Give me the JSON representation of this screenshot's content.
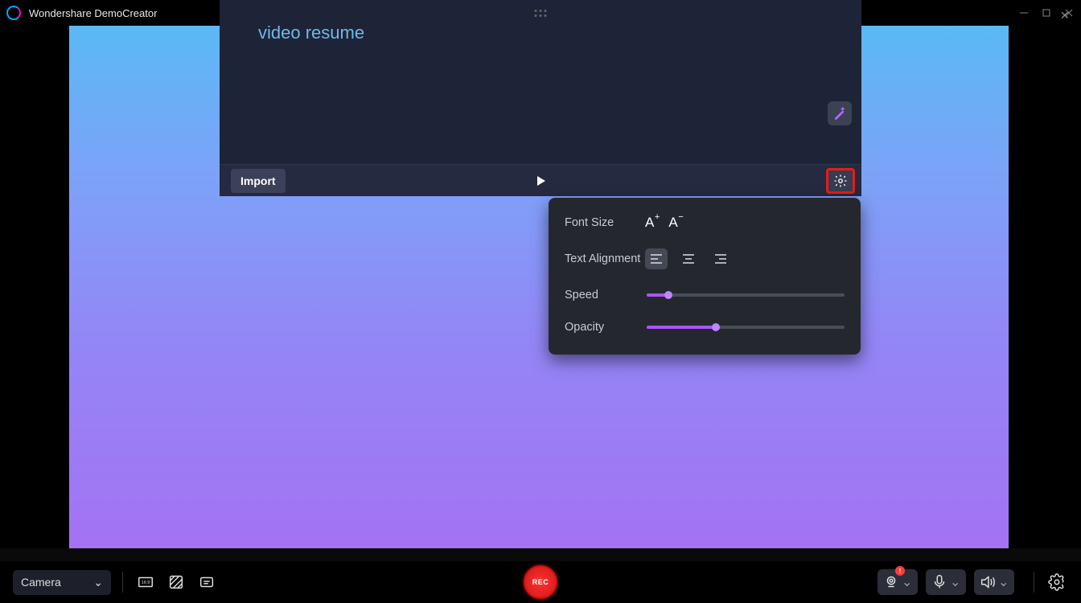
{
  "app": {
    "title": "Wondershare DemoCreator"
  },
  "teleprompter": {
    "text": "video resume",
    "import_label": "Import"
  },
  "popover": {
    "font_size_label": "Font Size",
    "alignment_label": "Text Alignment",
    "speed_label": "Speed",
    "opacity_label": "Opacity",
    "speed_value": 11,
    "opacity_value": 35
  },
  "bottombar": {
    "camera_label": "Camera",
    "rec_label": "REC"
  }
}
